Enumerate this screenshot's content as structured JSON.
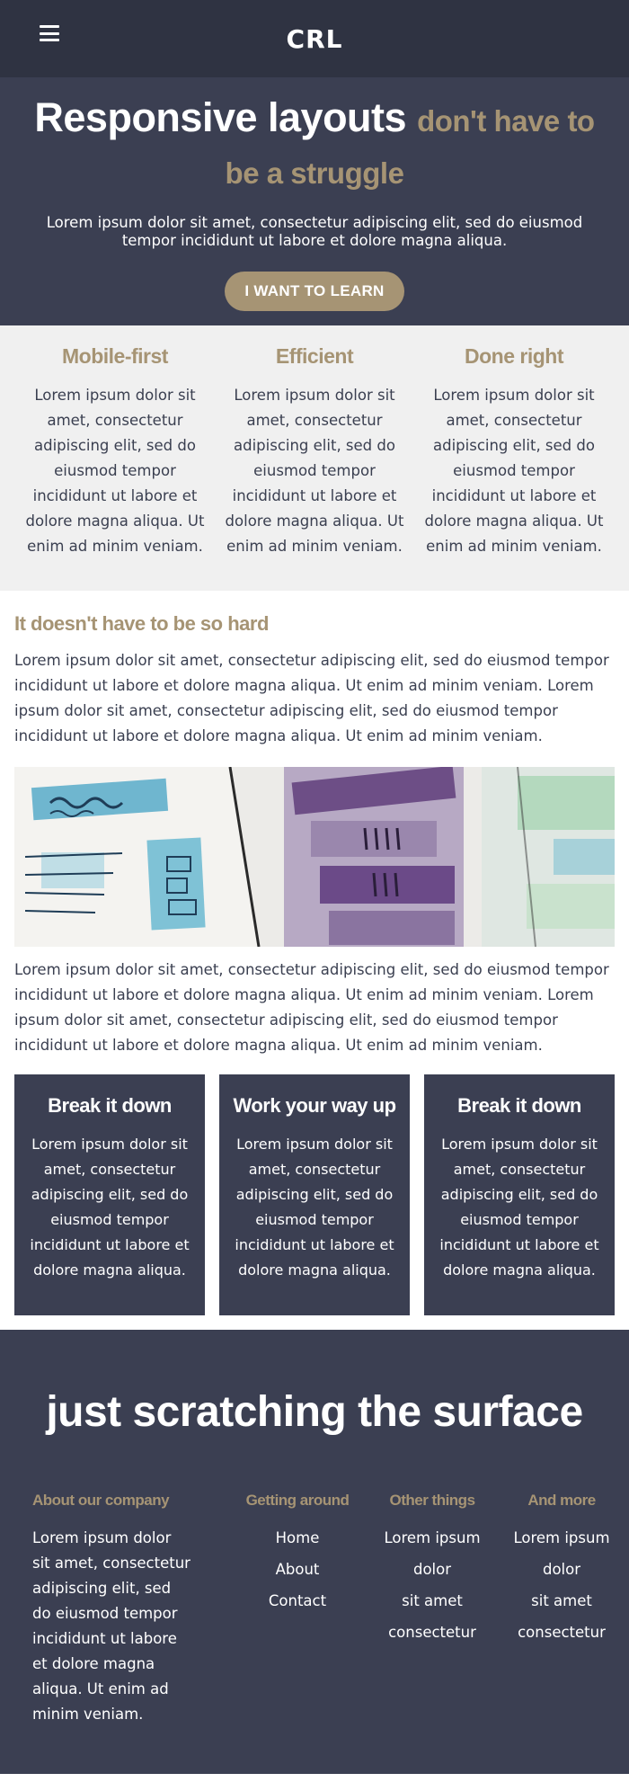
{
  "nav": {
    "logo": "CRL",
    "menu_icon": "hamburger-menu-icon"
  },
  "hero": {
    "title_main": "Responsive layouts",
    "title_accent": "don't have to be a struggle",
    "text": "Lorem ipsum dolor sit amet, consectetur adipiscing elit, sed do eiusmod tempor incididunt ut labore et dolore magna aliqua.",
    "cta_label": "I WANT TO LEARN"
  },
  "features": [
    {
      "title": "Mobile-first",
      "text": "Lorem ipsum dolor sit amet, consectetur adipiscing elit, sed do eiusmod tempor incididunt ut labore et dolore magna aliqua. Ut enim ad minim veniam."
    },
    {
      "title": "Efficient",
      "text": "Lorem ipsum dolor sit amet, consectetur adipiscing elit, sed do eiusmod tempor incididunt ut labore et dolore magna aliqua. Ut enim ad minim veniam."
    },
    {
      "title": "Done right",
      "text": "Lorem ipsum dolor sit amet, consectetur adipiscing elit, sed do eiusmod tempor incididunt ut labore et dolore magna aliqua. Ut enim ad minim veniam."
    }
  ],
  "content": {
    "title": "It doesn't have to be so hard",
    "paragraph1": "Lorem ipsum dolor sit amet, consectetur adipiscing elit, sed do eiusmod tempor incididunt ut labore et dolore magna aliqua. Ut enim ad minim veniam. Lorem ipsum dolor sit amet, consectetur adipiscing elit, sed do eiusmod tempor incididunt ut labore et dolore magna aliqua. Ut enim ad minim veniam.",
    "paragraph2": "Lorem ipsum dolor sit amet, consectetur adipiscing elit, sed do eiusmod tempor incididunt ut labore et dolore magna aliqua. Ut enim ad minim veniam. Lorem ipsum dolor sit amet, consectetur adipiscing elit, sed do eiusmod tempor incididunt ut labore et dolore magna aliqua. Ut enim ad minim veniam.",
    "image_icon": "wireframe-sketch-image"
  },
  "cards": [
    {
      "title": "Break it down",
      "text": "Lorem ipsum dolor sit amet, consectetur adipiscing elit, sed do eiusmod tempor incididunt ut labore et dolore magna aliqua."
    },
    {
      "title": "Work your way up",
      "text": "Lorem ipsum dolor sit amet, consectetur adipiscing elit, sed do eiusmod tempor incididunt ut labore et dolore magna aliqua."
    },
    {
      "title": "Break it down",
      "text": "Lorem ipsum dolor sit amet, consectetur adipiscing elit, sed do eiusmod tempor incididunt ut labore et dolore magna aliqua."
    }
  ],
  "footer": {
    "title": "just scratching the surface",
    "about": {
      "heading": "About our company",
      "text": "Lorem ipsum dolor sit amet, consectetur adipiscing elit, sed do eiusmod tempor incididunt ut labore et dolore magna aliqua. Ut enim ad minim veniam."
    },
    "getting_around": {
      "heading": "Getting around",
      "links": [
        "Home",
        "About",
        "Contact"
      ]
    },
    "other_things": {
      "heading": "Other things",
      "lines": [
        "Lorem ipsum",
        "dolor",
        "sit amet",
        "consectetur"
      ]
    },
    "and_more": {
      "heading": "And more",
      "lines": [
        "Lorem ipsum",
        "dolor",
        "sit amet",
        "consectetur"
      ]
    }
  },
  "colors": {
    "nav_bg": "#2f3342",
    "hero_bg": "#3b3f52",
    "accent": "#a69474",
    "light_bg": "#f0f0f0",
    "text": "#3a3f50"
  }
}
